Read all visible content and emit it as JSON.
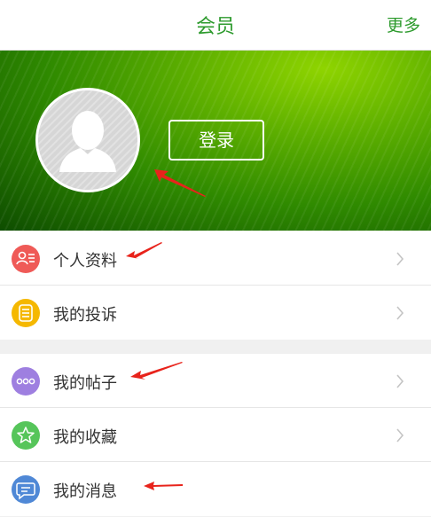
{
  "header": {
    "title": "会员",
    "more_label": "更多"
  },
  "profile": {
    "login_label": "登录"
  },
  "menu_group_1": [
    {
      "label": "个人资料",
      "icon": "profile-card-icon",
      "color": "#ef5a57"
    },
    {
      "label": "我的投诉",
      "icon": "complaint-list-icon",
      "color": "#f5b800"
    }
  ],
  "menu_group_2": [
    {
      "label": "我的帖子",
      "icon": "posts-dots-icon",
      "color": "#9e7fe0"
    },
    {
      "label": "我的收藏",
      "icon": "star-icon",
      "color": "#56c55a"
    },
    {
      "label": "我的消息",
      "icon": "message-bubble-icon",
      "color": "#4f88d6"
    }
  ],
  "colors": {
    "accent": "#2e9b2e",
    "annotation_arrow": "#e8231b"
  }
}
